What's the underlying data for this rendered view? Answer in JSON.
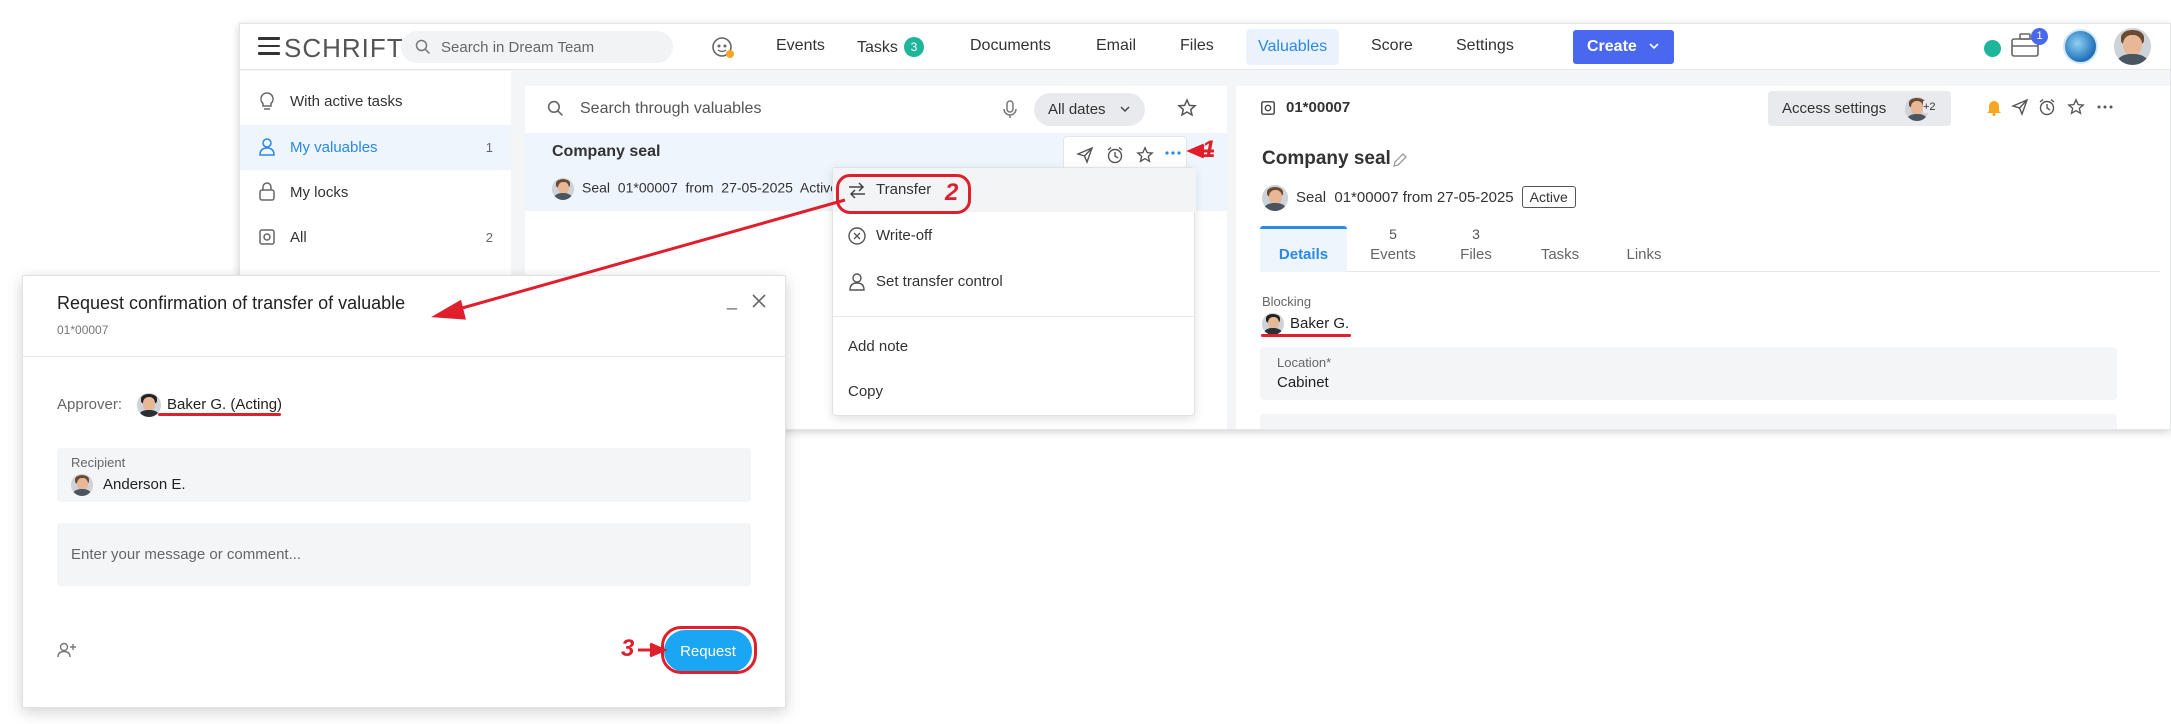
{
  "app": {
    "logo": "SCHRIFT",
    "search_placeholder": "Search in Dream Team",
    "nav": [
      {
        "label": "Events"
      },
      {
        "label": "Tasks",
        "badge": "3"
      },
      {
        "label": "Documents"
      },
      {
        "label": "Email"
      },
      {
        "label": "Files"
      },
      {
        "label": "Valuables",
        "active": true
      },
      {
        "label": "Score"
      },
      {
        "label": "Settings"
      }
    ],
    "create_label": "Create",
    "briefcase_badge": "1"
  },
  "sidebar": {
    "items": [
      {
        "label": "With active tasks",
        "count": ""
      },
      {
        "label": "My valuables",
        "count": "1",
        "active": true
      },
      {
        "label": "My locks",
        "count": ""
      },
      {
        "label": "All",
        "count": "2"
      }
    ]
  },
  "list": {
    "search_placeholder": "Search through valuables",
    "dates_label": "All dates",
    "row": {
      "title": "Company seal",
      "subtitle": "Seal  01*00007  from  27-05-2025  Active"
    }
  },
  "menu": {
    "items": [
      "Transfer",
      "Write-off",
      "Set transfer control",
      "Add note",
      "Copy"
    ]
  },
  "detail": {
    "id": "01*00007",
    "access_label": "Access settings",
    "access_more": "+2",
    "title": "Company seal",
    "subtitle": "Seal  01*00007 from 27-05-2025",
    "status": "Active",
    "tabs": [
      {
        "count": "",
        "label": "Details",
        "active": true
      },
      {
        "count": "5",
        "label": "Events"
      },
      {
        "count": "3",
        "label": "Files"
      },
      {
        "count": "",
        "label": "Tasks"
      },
      {
        "count": "",
        "label": "Links"
      }
    ],
    "blocking_label": "Blocking",
    "blocking_value": "Baker G.",
    "location_label": "Location*",
    "location_value": "Cabinet"
  },
  "dialog": {
    "title": "Request confirmation of transfer of valuable",
    "id": "01*00007",
    "min": "_",
    "approver_label": "Approver:",
    "approver_value": "Baker G. (Acting)",
    "recipient_label": "Recipient",
    "recipient_value": "Anderson E.",
    "message_placeholder": "Enter your message or comment...",
    "request_label": "Request"
  },
  "annotations": {
    "n1": "1",
    "n2": "2",
    "n3": "3"
  },
  "colors": {
    "accent": "#2a88e6",
    "create": "#4a67f0",
    "teal": "#1fb59a",
    "request": "#1aa6f2",
    "annotation": "#e01f2c"
  }
}
